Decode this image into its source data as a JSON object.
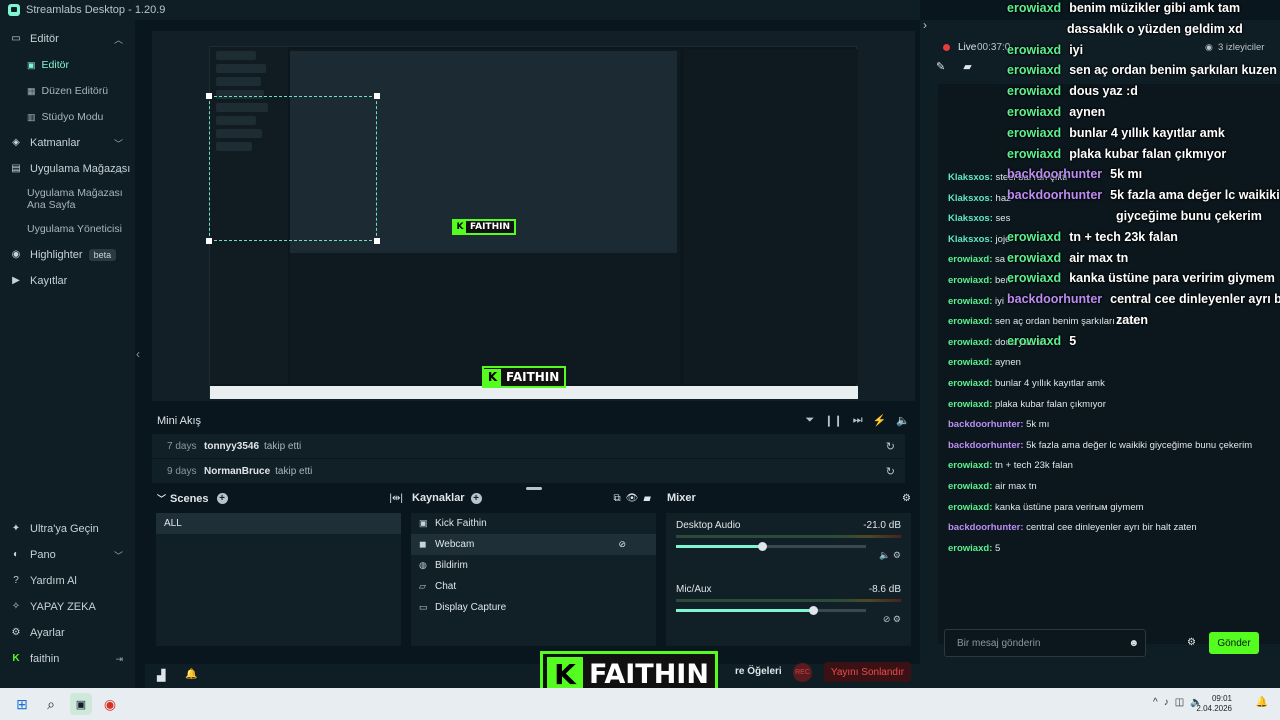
{
  "app": {
    "title": "Streamlabs Desktop - 1.20.9"
  },
  "nav": {
    "editor": "Editör",
    "editor_sub": "Editör",
    "layout_editor": "Düzen Editörü",
    "studio_mode": "Stüdyo Modu",
    "layers": "Katmanlar",
    "app_store": "Uygulama Mağazası",
    "app_store_home": [
      "Uygulama Mağazası",
      "Ana Sayfa"
    ],
    "app_manager": "Uygulama Yöneticisi",
    "highlighter": "Highlighter",
    "highlighter_badge": "beta",
    "recordings": "Kayıtlar",
    "ultra": "Ultra'ya Geçin",
    "dashboard": "Pano",
    "help": "Yardım Al",
    "ai": "YAPAY ZEKA",
    "settings": "Ayarlar",
    "user": "faithin"
  },
  "mini_feed": {
    "title": "Mini Akış",
    "rows": [
      {
        "days": "7 days",
        "user": "tonnyy3546",
        "action": "takip etti"
      },
      {
        "days": "9 days",
        "user": "NormanBruce",
        "action": "takip etti"
      }
    ]
  },
  "scenes": {
    "title": "Scenes",
    "items": [
      "ALL"
    ]
  },
  "sources": {
    "title": "Kaynaklar",
    "items": [
      {
        "label": "Kick Faithin",
        "icon": "image-icon"
      },
      {
        "label": "Webcam",
        "icon": "camera-icon"
      },
      {
        "label": "Bildirim",
        "icon": "globe-icon"
      },
      {
        "label": "Chat",
        "icon": "chat-icon"
      },
      {
        "label": "Display Capture",
        "icon": "monitor-icon"
      }
    ]
  },
  "mixer": {
    "title": "Mixer",
    "channels": [
      {
        "name": "Desktop Audio",
        "db": "-21.0 dB",
        "level": 0.45
      },
      {
        "name": "Mic/Aux",
        "db": "-8.6 dB",
        "level": 0.72
      }
    ]
  },
  "footer": {
    "scene_items": "re Öğeleri",
    "rec": "REC",
    "end_stream": "Yayını Sonlandır"
  },
  "overlay_badge": "FAITHIN",
  "chat_panel": {
    "live": "Live",
    "time": "00:37:0",
    "viewers": "3 izleyiciler",
    "placeholder": "Bir mesaj gönderin",
    "send": "Gönder",
    "messages": [
      {
        "user": "Klaksxos",
        "text": "steel bal run çıktı",
        "color": "t"
      },
      {
        "user": "Klaksxos",
        "text": "haz",
        "color": "t"
      },
      {
        "user": "Klaksxos",
        "text": "ses",
        "color": "t"
      },
      {
        "user": "Klaksxos",
        "text": "joje",
        "color": "t"
      },
      {
        "user": "erowiaxd",
        "text": "sa",
        "color": "g"
      },
      {
        "user": "erowiaxd",
        "text": "ben",
        "color": "g"
      },
      {
        "user": "erowiaxd",
        "text": "iyi",
        "color": "g"
      },
      {
        "user": "erowiaxd",
        "text": "sen aç ordan benim şarkıları kuzen",
        "color": "g"
      },
      {
        "user": "erowiaxd",
        "text": "dous yaz :d",
        "color": "g"
      },
      {
        "user": "erowiaxd",
        "text": "aynen",
        "color": "g"
      },
      {
        "user": "erowiaxd",
        "text": "bunlar 4 yıllık kayıtlar amk",
        "color": "g"
      },
      {
        "user": "erowiaxd",
        "text": "plaka kubar falan çıkmıyor",
        "color": "g"
      },
      {
        "user": "backdoorhunter",
        "text": "5k mı",
        "color": "p"
      },
      {
        "user": "backdoorhunter",
        "text": "5k fazla ama değer lc waikiki giyceğime bunu çekerim",
        "color": "p"
      },
      {
        "user": "erowiaxd",
        "text": "tn + tech 23k falan",
        "color": "g"
      },
      {
        "user": "erowiaxd",
        "text": "air max tn",
        "color": "g"
      },
      {
        "user": "erowiaxd",
        "text": "kanka üstüne para verirым giymem",
        "color": "g"
      },
      {
        "user": "backdoorhunter",
        "text": "central cee dinleyenler ayrı bir halt zaten",
        "color": "p"
      },
      {
        "user": "erowiaxd",
        "text": "5",
        "color": "g"
      }
    ]
  },
  "overlay_chat": [
    {
      "user": "erowiaxd",
      "text": "benim müzikler gibi amk tam",
      "color": "g"
    },
    {
      "user": "",
      "text": "dassaklık o yüzden geldim xd",
      "color": "g"
    },
    {
      "user": "erowiaxd",
      "text": "iyi",
      "color": "g"
    },
    {
      "user": "erowiaxd",
      "text": "sen aç ordan benim şarkıları kuzen",
      "color": "g"
    },
    {
      "user": "erowiaxd",
      "text": "dous yaz :d",
      "color": "g"
    },
    {
      "user": "erowiaxd",
      "text": "aynen",
      "color": "g"
    },
    {
      "user": "erowiaxd",
      "text": "bunlar 4 yıllık kayıtlar amk",
      "color": "g"
    },
    {
      "user": "erowiaxd",
      "text": "plaka kubar falan çıkmıyor",
      "color": "g"
    },
    {
      "user": "backdoorhunter",
      "text": "5k mı",
      "color": "p"
    },
    {
      "user": "backdoorhunter",
      "text": "5k fazla ama değer lc waikiki",
      "color": "p"
    },
    {
      "user": "",
      "text": "giyceğime bunu çekerim",
      "color": "p"
    },
    {
      "user": "erowiaxd",
      "text": "tn + tech 23k falan",
      "color": "g"
    },
    {
      "user": "erowiaxd",
      "text": "air max tn",
      "color": "g"
    },
    {
      "user": "erowiaxd",
      "text": "kanka üstüne para veririm giymem",
      "color": "g"
    },
    {
      "user": "backdoorhunter",
      "text": "central cee dinleyenler ayrı bir halt",
      "color": "p"
    },
    {
      "user": "",
      "text": "zaten",
      "color": "p"
    },
    {
      "user": "erowiaxd",
      "text": "5",
      "color": "g"
    }
  ],
  "taskbar": {
    "time": "09:01",
    "date": "2.04.2026"
  },
  "colors": {
    "accent": "#80f5d2",
    "kick_green": "#54fc1f",
    "live_red": "#e63c3c"
  }
}
